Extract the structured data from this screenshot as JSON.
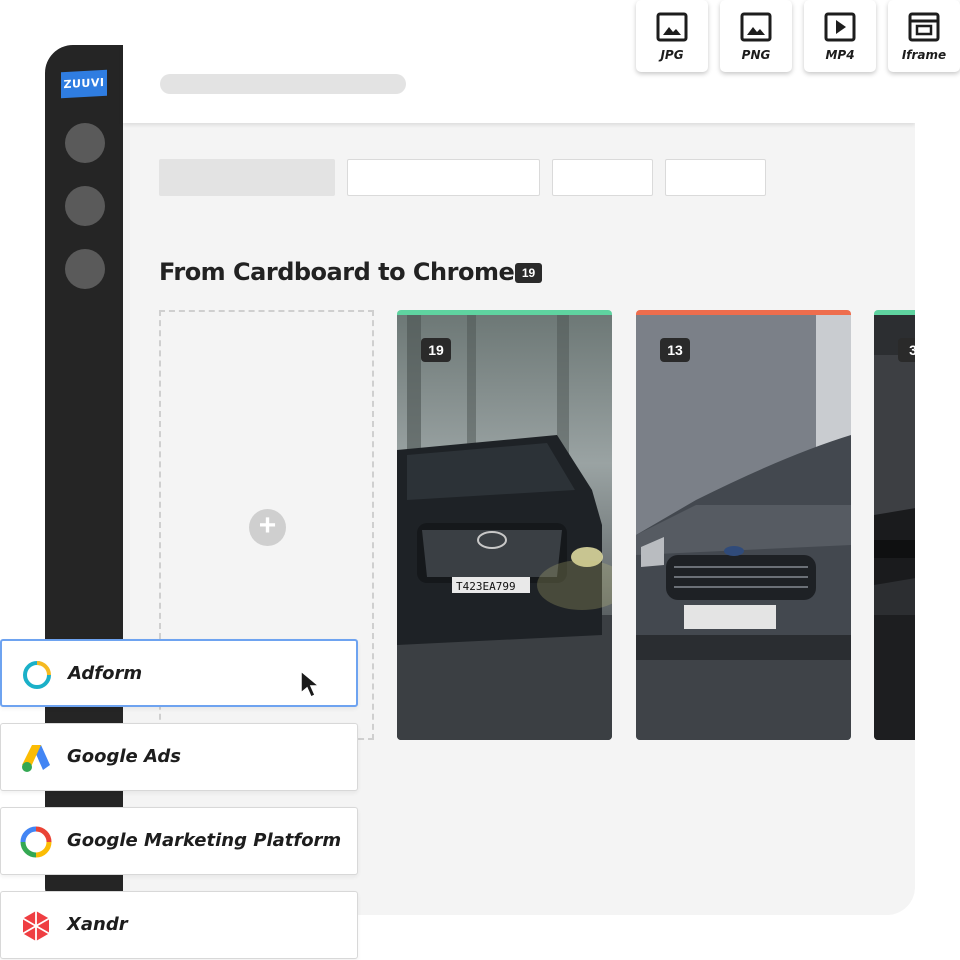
{
  "app": {
    "logo_text": "ZUUVI",
    "brand_color": "#2f7de1"
  },
  "section": {
    "title": "From Cardboard to Chrome.",
    "count": "19"
  },
  "cards": [
    {
      "count": "19",
      "status_color": "#5fd3a0",
      "image": "hyundai-suv-in-fog"
    },
    {
      "count": "13",
      "status_color": "#ee6d4d",
      "image": "ford-focus-grey"
    },
    {
      "count": "3",
      "status_color": "#5fd3a0",
      "image": "dark-car-closeup"
    }
  ],
  "exports": [
    {
      "label": "JPG",
      "icon": "image-icon"
    },
    {
      "label": "PNG",
      "icon": "image-icon"
    },
    {
      "label": "MP4",
      "icon": "video-icon"
    },
    {
      "label": "Iframe",
      "icon": "iframe-icon"
    }
  ],
  "integrations": [
    {
      "label": "Adform",
      "icon": "adform-icon",
      "selected": true
    },
    {
      "label": "Google Ads",
      "icon": "google-ads-icon",
      "selected": false
    },
    {
      "label": "Google Marketing Platform",
      "icon": "google-marketing-platform-icon",
      "selected": false
    },
    {
      "label": "Xandr",
      "icon": "xandr-icon",
      "selected": false
    }
  ],
  "colors": {
    "sidebar": "#252525",
    "workspace": "#f4f4f4",
    "selected_border": "#6ea3f0"
  }
}
